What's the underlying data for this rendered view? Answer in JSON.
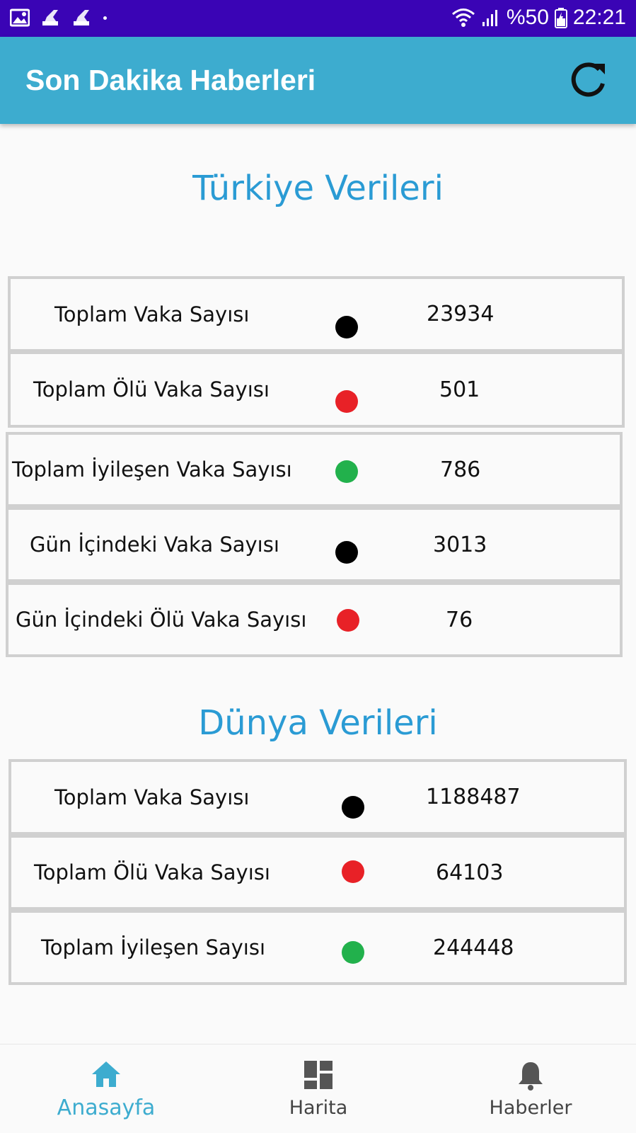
{
  "status_bar": {
    "battery": "%50",
    "time": "22:21"
  },
  "app_bar": {
    "title": "Son Dakika Haberleri",
    "refresh_icon": "refresh-icon"
  },
  "turkey": {
    "title": "Türkiye Verileri",
    "rows": [
      {
        "label": "Toplam Vaka Sayısı",
        "value": "23934",
        "dot": "#000000"
      },
      {
        "label": "Toplam Ölü Vaka Sayısı",
        "value": "501",
        "dot": "#e82127"
      },
      {
        "label": "Toplam İyileşen Vaka Sayısı",
        "value": "786",
        "dot": "#22b14c"
      },
      {
        "label": "Gün İçindeki Vaka Sayısı",
        "value": "3013",
        "dot": "#000000"
      },
      {
        "label": "Gün İçindeki Ölü Vaka Sayısı",
        "value": "76",
        "dot": "#e82127"
      }
    ]
  },
  "world": {
    "title": "Dünya Verileri",
    "rows": [
      {
        "label": "Toplam Vaka Sayısı",
        "value": "1188487",
        "dot": "#000000"
      },
      {
        "label": "Toplam Ölü Vaka Sayısı",
        "value": "64103",
        "dot": "#e82127"
      },
      {
        "label": "Toplam İyileşen Sayısı",
        "value": "244448",
        "dot": "#22b14c"
      }
    ]
  },
  "bottom_nav": {
    "items": [
      {
        "label": "Anasayfa",
        "icon": "home-icon",
        "active": true
      },
      {
        "label": "Harita",
        "icon": "dashboard-icon",
        "active": false
      },
      {
        "label": "Haberler",
        "icon": "bell-icon",
        "active": false
      }
    ]
  },
  "colors": {
    "status_bar": "#3a04b5",
    "app_bar": "#3daccf",
    "section_title": "#2a9bd4",
    "nav_active": "#3daccf",
    "nav_inactive": "#555555"
  }
}
